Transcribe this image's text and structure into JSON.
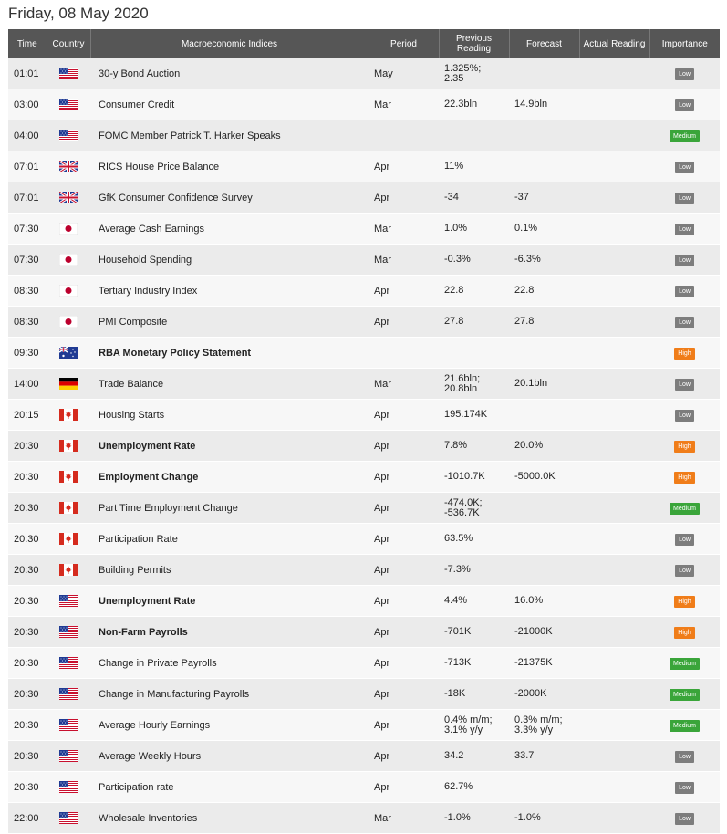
{
  "header": {
    "date": "Friday, 08 May 2020"
  },
  "columns": {
    "time": "Time",
    "country": "Country",
    "indices": "Macroeconomic Indices",
    "period": "Period",
    "previous": "Previous Reading",
    "forecast": "Forecast",
    "actual": "Actual Reading",
    "importance": "Importance"
  },
  "importance_colors": {
    "Low": "#7d7d7d",
    "Medium": "#3aa53a",
    "High": "#f07d19"
  },
  "rows": [
    {
      "time": "01:01",
      "country": "us-flag-icon",
      "name": "30-y Bond Auction",
      "bold": false,
      "period": "May",
      "previous": "1.325%;\n2.35",
      "forecast": "",
      "actual": "",
      "importance": "Low"
    },
    {
      "time": "03:00",
      "country": "us-flag-icon",
      "name": "Consumer Credit",
      "bold": false,
      "period": "Mar",
      "previous": "22.3bln",
      "forecast": "14.9bln",
      "actual": "",
      "importance": "Low"
    },
    {
      "time": "04:00",
      "country": "us-flag-icon",
      "name": "FOMC Member Patrick T. Harker Speaks",
      "bold": false,
      "period": "",
      "previous": "",
      "forecast": "",
      "actual": "",
      "importance": "Medium"
    },
    {
      "time": "07:01",
      "country": "uk-flag-icon",
      "name": "RICS House Price Balance",
      "bold": false,
      "period": "Apr",
      "previous": "11%",
      "forecast": "",
      "actual": "",
      "importance": "Low"
    },
    {
      "time": "07:01",
      "country": "uk-flag-icon",
      "name": "GfK Consumer Confidence Survey",
      "bold": false,
      "period": "Apr",
      "previous": "-34",
      "forecast": "-37",
      "actual": "",
      "importance": "Low"
    },
    {
      "time": "07:30",
      "country": "japan-flag-icon",
      "name": "Average Cash Earnings",
      "bold": false,
      "period": "Mar",
      "previous": "1.0%",
      "forecast": "0.1%",
      "actual": "",
      "importance": "Low"
    },
    {
      "time": "07:30",
      "country": "japan-flag-icon",
      "name": "Household Spending",
      "bold": false,
      "period": "Mar",
      "previous": "-0.3%",
      "forecast": "-6.3%",
      "actual": "",
      "importance": "Low"
    },
    {
      "time": "08:30",
      "country": "japan-flag-icon",
      "name": "Tertiary Industry Index",
      "bold": false,
      "period": "Apr",
      "previous": "22.8",
      "forecast": "22.8",
      "actual": "",
      "importance": "Low"
    },
    {
      "time": "08:30",
      "country": "japan-flag-icon",
      "name": "PMI Composite",
      "bold": false,
      "period": "Apr",
      "previous": "27.8",
      "forecast": "27.8",
      "actual": "",
      "importance": "Low"
    },
    {
      "time": "09:30",
      "country": "australia-flag-icon",
      "name": "RBA Monetary Policy Statement",
      "bold": true,
      "period": "",
      "previous": "",
      "forecast": "",
      "actual": "",
      "importance": "High"
    },
    {
      "time": "14:00",
      "country": "germany-flag-icon",
      "name": "Trade Balance",
      "bold": false,
      "period": "Mar",
      "previous": "21.6bln;\n20.8bln",
      "forecast": "20.1bln",
      "actual": "",
      "importance": "Low"
    },
    {
      "time": "20:15",
      "country": "canada-flag-icon",
      "name": "Housing Starts",
      "bold": false,
      "period": "Apr",
      "previous": "195.174K",
      "forecast": "",
      "actual": "",
      "importance": "Low"
    },
    {
      "time": "20:30",
      "country": "canada-flag-icon",
      "name": "Unemployment Rate",
      "bold": true,
      "period": "Apr",
      "previous": "7.8%",
      "forecast": "20.0%",
      "actual": "",
      "importance": "High"
    },
    {
      "time": "20:30",
      "country": "canada-flag-icon",
      "name": "Employment Change",
      "bold": true,
      "period": "Apr",
      "previous": "-1010.7K",
      "forecast": "-5000.0K",
      "actual": "",
      "importance": "High"
    },
    {
      "time": "20:30",
      "country": "canada-flag-icon",
      "name": "Part Time Employment Change",
      "bold": false,
      "period": "Apr",
      "previous": "-474.0K;\n-536.7K",
      "forecast": "",
      "actual": "",
      "importance": "Medium"
    },
    {
      "time": "20:30",
      "country": "canada-flag-icon",
      "name": "Participation Rate",
      "bold": false,
      "period": "Apr",
      "previous": "63.5%",
      "forecast": "",
      "actual": "",
      "importance": "Low"
    },
    {
      "time": "20:30",
      "country": "canada-flag-icon",
      "name": "Building Permits",
      "bold": false,
      "period": "Apr",
      "previous": "-7.3%",
      "forecast": "",
      "actual": "",
      "importance": "Low"
    },
    {
      "time": "20:30",
      "country": "us-flag-icon",
      "name": "Unemployment Rate",
      "bold": true,
      "period": "Apr",
      "previous": "4.4%",
      "forecast": "16.0%",
      "actual": "",
      "importance": "High"
    },
    {
      "time": "20:30",
      "country": "us-flag-icon",
      "name": "Non-Farm Payrolls",
      "bold": true,
      "period": "Apr",
      "previous": "-701K",
      "forecast": "-21000K",
      "actual": "",
      "importance": "High"
    },
    {
      "time": "20:30",
      "country": "us-flag-icon",
      "name": "Change in Private Payrolls",
      "bold": false,
      "period": "Apr",
      "previous": "-713K",
      "forecast": "-21375K",
      "actual": "",
      "importance": "Medium"
    },
    {
      "time": "20:30",
      "country": "us-flag-icon",
      "name": "Change in Manufacturing Payrolls",
      "bold": false,
      "period": "Apr",
      "previous": "-18K",
      "forecast": "-2000K",
      "actual": "",
      "importance": "Medium"
    },
    {
      "time": "20:30",
      "country": "us-flag-icon",
      "name": "Average Hourly Earnings",
      "bold": false,
      "period": "Apr",
      "previous": "0.4% m/m;\n3.1% y/y",
      "forecast": "0.3% m/m;\n3.3% y/y",
      "actual": "",
      "importance": "Medium"
    },
    {
      "time": "20:30",
      "country": "us-flag-icon",
      "name": "Average Weekly Hours",
      "bold": false,
      "period": "Apr",
      "previous": "34.2",
      "forecast": "33.7",
      "actual": "",
      "importance": "Low"
    },
    {
      "time": "20:30",
      "country": "us-flag-icon",
      "name": "Participation rate",
      "bold": false,
      "period": "Apr",
      "previous": "62.7%",
      "forecast": "",
      "actual": "",
      "importance": "Low"
    },
    {
      "time": "22:00",
      "country": "us-flag-icon",
      "name": "Wholesale Inventories",
      "bold": false,
      "period": "Mar",
      "previous": "-1.0%",
      "forecast": "-1.0%",
      "actual": "",
      "importance": "Low"
    }
  ]
}
